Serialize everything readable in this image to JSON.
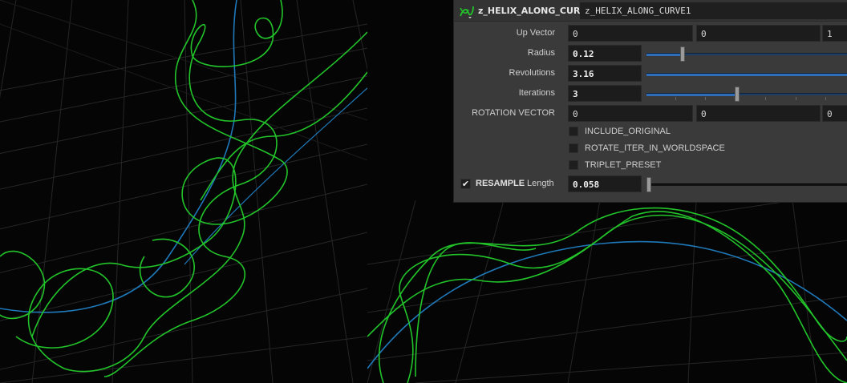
{
  "node": {
    "type_label": "z_HELIX_ALONG_CURVE",
    "name": "z_HELIX_ALONG_CURVE1",
    "icon": "helix-node-icon"
  },
  "params": {
    "up_vector": {
      "label": "Up Vector",
      "x": "0",
      "y": "0",
      "z": "1"
    },
    "radius": {
      "label": "Radius",
      "value": "0.12",
      "slider_fraction": 0.18
    },
    "revolutions": {
      "label": "Revolutions",
      "value": "3.16",
      "slider_fraction": 1.0
    },
    "iterations": {
      "label": "Iterations",
      "value": "3",
      "slider_fraction": 0.45
    },
    "rotation_vector": {
      "label": "ROTATION VECTOR",
      "x": "0",
      "y": "0",
      "z": "0"
    },
    "include_original": {
      "label": "INCLUDE_ORIGINAL",
      "checked": false
    },
    "rotate_iter": {
      "label": "ROTATE_ITER_IN_WORLDSPACE",
      "checked": false
    },
    "triplet_preset": {
      "label": "TRIPLET_PRESET",
      "checked": false
    },
    "resample": {
      "toggle_label": "RESAMPLE",
      "checked": true,
      "length_label": "Length",
      "value": "0.058",
      "slider_fraction": 0.0
    }
  },
  "colors": {
    "helix": "#22c42a",
    "curve": "#1f78b8",
    "grid": "#2b2b2b",
    "slider_fill": "#2f6db8"
  }
}
